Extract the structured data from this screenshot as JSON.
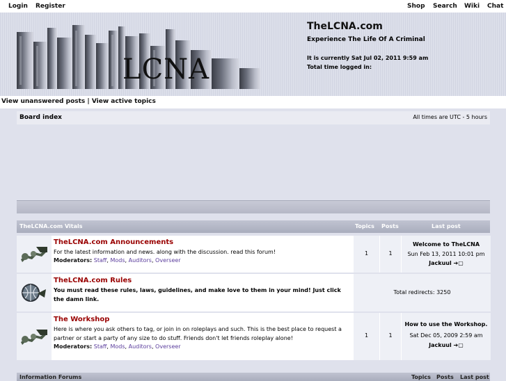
{
  "topnav": {
    "login": "Login",
    "register": "Register",
    "shop": "Shop",
    "search": "Search",
    "wiki": "Wiki",
    "chat": "Chat"
  },
  "header": {
    "logo_text": "LCNA",
    "site_title": "TheLCNA.com",
    "tagline": "Experience The Life Of A Criminal",
    "current_time": "It is currently Sat Jul 02, 2011 9:59 am",
    "time_logged": "Total time logged in:"
  },
  "links": {
    "text": "View unanswered posts | View active topics"
  },
  "nav": {
    "board_index": "Board index",
    "timezone": "All times are UTC - 5 hours"
  },
  "table": {
    "category": "TheLCNA.com Vitals",
    "col_topics": "Topics",
    "col_posts": "Posts",
    "col_last": "Last post"
  },
  "forums": [
    {
      "title": "TheLCNA.com Announcements",
      "desc": "For the latest information and news. along with the discussion. read this forum!",
      "mods_label": "Moderators:",
      "mods": [
        "Staff",
        "Mods",
        "Auditors",
        "Overseer"
      ],
      "topics": "1",
      "posts": "1",
      "last_title": "Welcome to TheLCNA",
      "last_date": "Sun Feb 13, 2011 10:01 pm",
      "last_user": "Jackuul"
    },
    {
      "title": "TheLCNA.com Rules",
      "desc": "You must read these rules, laws, guidelines, and make love to them in your mind! Just click the damn link.",
      "redirects": "Total redirects: 3250"
    },
    {
      "title": "The Workshop",
      "desc": "Here is where you ask others to tag, or join in on roleplays and such. This is the best place to request a partner or start a party of any size to do stuff. Friends don't let friends roleplay alone!",
      "mods_label": "Moderators:",
      "mods": [
        "Staff",
        "Mods",
        "Auditors",
        "Overseer"
      ],
      "topics": "1",
      "posts": "1",
      "last_title": "How to use the Workshop.",
      "last_date": "Sat Dec 05, 2009 2:59 am",
      "last_user": "Jackuul"
    }
  ],
  "next_category": {
    "title": "Information Forums",
    "col_topics": "Topics",
    "col_posts": "Posts",
    "col_last": "Last post"
  },
  "icons": {
    "forum": "forum-read-icon",
    "redirect": "forum-link-icon",
    "go_latest": "view-latest-post-icon"
  }
}
